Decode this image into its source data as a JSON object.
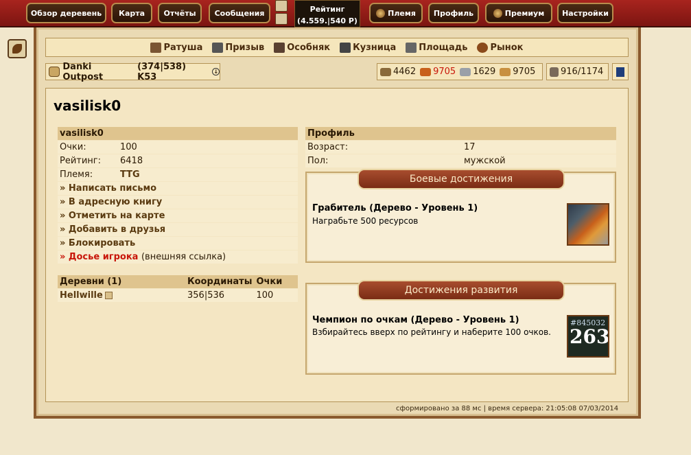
{
  "nav": {
    "overview": "Обзор деревень",
    "map": "Карта",
    "reports": "Отчёты",
    "messages": "Сообщения",
    "tribe": "Племя",
    "profile": "Профиль",
    "premium": "Премиум",
    "settings": "Настройки"
  },
  "rank": {
    "label": "Рейтинг",
    "value": "(4.559.|540 Р)"
  },
  "buildings": [
    "Ратуша",
    "Призыв",
    "Особняк",
    "Кузница",
    "Площадь",
    "Рынок"
  ],
  "village": {
    "name": "Danki Outpost",
    "coords": "(374|538) K53"
  },
  "resources": {
    "wood": "4462",
    "clay": "9705",
    "iron": "1629",
    "storage": "9705",
    "population": "916/1174"
  },
  "player": {
    "title": "vasilisk0",
    "table_header": "vasilisk0",
    "points_label": "Очки:",
    "points": "100",
    "rank_label": "Рейтинг:",
    "rank": "6418",
    "tribe_label": "Племя:",
    "tribe": "TTG"
  },
  "actions": {
    "write_message": "» Написать письмо",
    "address_book": "» В адресную книгу",
    "mark_on_map": "» Отметить на карте",
    "add_friend": "» Добавить в друзья",
    "block": "» Блокировать",
    "dossier": "» Досье игрока",
    "external": "(внешняя ссылка)"
  },
  "villages": {
    "headers": [
      "Деревни (1)",
      "Координаты",
      "Очки"
    ],
    "rows": [
      {
        "name": "Hellwille",
        "coords": "356|536",
        "points": "100"
      }
    ]
  },
  "profile": {
    "header": "Профиль",
    "age_label": "Возраст:",
    "age": "17",
    "gender_label": "Пол:",
    "gender": "мужской"
  },
  "achievements": {
    "combat": {
      "heading": "Боевые достижения",
      "title": "Грабитель (Дерево - Уровень 1)",
      "desc": "Награбьте 500 ресурсов"
    },
    "development": {
      "heading": "Достижения развития",
      "title": "Чемпион по очкам (Дерево - Уровень 1)",
      "desc": "Взбирайтесь вверх по рейтингу и наберите 100 очков.",
      "img_top": "#845032",
      "img_big": "263"
    }
  },
  "footer": "сформировано за 88 мс | время сервера: 21:05:08 07/03/2014"
}
